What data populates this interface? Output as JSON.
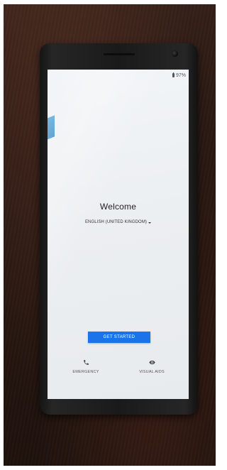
{
  "status_bar": {
    "battery": "97%"
  },
  "welcome": {
    "title": "Welcome",
    "language": "ENGLISH (UNITED KINGDOM)"
  },
  "actions": {
    "get_started": "GET STARTED",
    "emergency": "EMERGENCY",
    "visual_aids": "VISUAL AIDS"
  },
  "icons": {
    "battery": "battery-icon",
    "language_caret": "chevron-down-icon",
    "emergency": "phone-icon",
    "visual_aids": "eye-icon"
  },
  "colors": {
    "accent": "#1a73e8",
    "screen_background": "#eceff1",
    "text": "#222222"
  }
}
